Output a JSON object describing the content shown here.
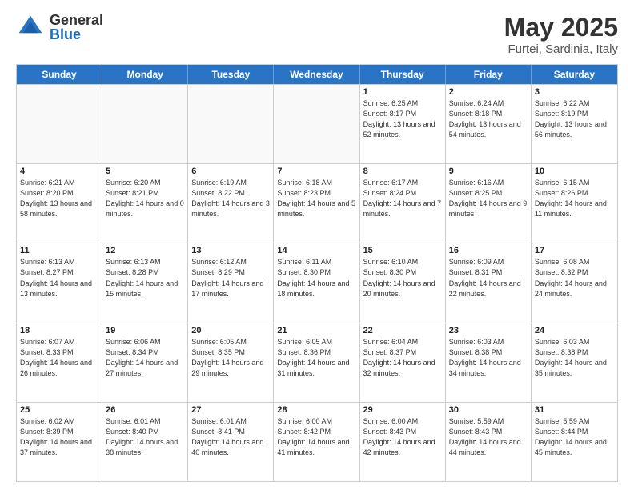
{
  "logo": {
    "general": "General",
    "blue": "Blue"
  },
  "header": {
    "month": "May 2025",
    "location": "Furtei, Sardinia, Italy"
  },
  "days": [
    "Sunday",
    "Monday",
    "Tuesday",
    "Wednesday",
    "Thursday",
    "Friday",
    "Saturday"
  ],
  "rows": [
    [
      {
        "day": "",
        "sunrise": "",
        "sunset": "",
        "daylight": ""
      },
      {
        "day": "",
        "sunrise": "",
        "sunset": "",
        "daylight": ""
      },
      {
        "day": "",
        "sunrise": "",
        "sunset": "",
        "daylight": ""
      },
      {
        "day": "",
        "sunrise": "",
        "sunset": "",
        "daylight": ""
      },
      {
        "day": "1",
        "sunrise": "Sunrise: 6:25 AM",
        "sunset": "Sunset: 8:17 PM",
        "daylight": "Daylight: 13 hours and 52 minutes."
      },
      {
        "day": "2",
        "sunrise": "Sunrise: 6:24 AM",
        "sunset": "Sunset: 8:18 PM",
        "daylight": "Daylight: 13 hours and 54 minutes."
      },
      {
        "day": "3",
        "sunrise": "Sunrise: 6:22 AM",
        "sunset": "Sunset: 8:19 PM",
        "daylight": "Daylight: 13 hours and 56 minutes."
      }
    ],
    [
      {
        "day": "4",
        "sunrise": "Sunrise: 6:21 AM",
        "sunset": "Sunset: 8:20 PM",
        "daylight": "Daylight: 13 hours and 58 minutes."
      },
      {
        "day": "5",
        "sunrise": "Sunrise: 6:20 AM",
        "sunset": "Sunset: 8:21 PM",
        "daylight": "Daylight: 14 hours and 0 minutes."
      },
      {
        "day": "6",
        "sunrise": "Sunrise: 6:19 AM",
        "sunset": "Sunset: 8:22 PM",
        "daylight": "Daylight: 14 hours and 3 minutes."
      },
      {
        "day": "7",
        "sunrise": "Sunrise: 6:18 AM",
        "sunset": "Sunset: 8:23 PM",
        "daylight": "Daylight: 14 hours and 5 minutes."
      },
      {
        "day": "8",
        "sunrise": "Sunrise: 6:17 AM",
        "sunset": "Sunset: 8:24 PM",
        "daylight": "Daylight: 14 hours and 7 minutes."
      },
      {
        "day": "9",
        "sunrise": "Sunrise: 6:16 AM",
        "sunset": "Sunset: 8:25 PM",
        "daylight": "Daylight: 14 hours and 9 minutes."
      },
      {
        "day": "10",
        "sunrise": "Sunrise: 6:15 AM",
        "sunset": "Sunset: 8:26 PM",
        "daylight": "Daylight: 14 hours and 11 minutes."
      }
    ],
    [
      {
        "day": "11",
        "sunrise": "Sunrise: 6:13 AM",
        "sunset": "Sunset: 8:27 PM",
        "daylight": "Daylight: 14 hours and 13 minutes."
      },
      {
        "day": "12",
        "sunrise": "Sunrise: 6:13 AM",
        "sunset": "Sunset: 8:28 PM",
        "daylight": "Daylight: 14 hours and 15 minutes."
      },
      {
        "day": "13",
        "sunrise": "Sunrise: 6:12 AM",
        "sunset": "Sunset: 8:29 PM",
        "daylight": "Daylight: 14 hours and 17 minutes."
      },
      {
        "day": "14",
        "sunrise": "Sunrise: 6:11 AM",
        "sunset": "Sunset: 8:30 PM",
        "daylight": "Daylight: 14 hours and 18 minutes."
      },
      {
        "day": "15",
        "sunrise": "Sunrise: 6:10 AM",
        "sunset": "Sunset: 8:30 PM",
        "daylight": "Daylight: 14 hours and 20 minutes."
      },
      {
        "day": "16",
        "sunrise": "Sunrise: 6:09 AM",
        "sunset": "Sunset: 8:31 PM",
        "daylight": "Daylight: 14 hours and 22 minutes."
      },
      {
        "day": "17",
        "sunrise": "Sunrise: 6:08 AM",
        "sunset": "Sunset: 8:32 PM",
        "daylight": "Daylight: 14 hours and 24 minutes."
      }
    ],
    [
      {
        "day": "18",
        "sunrise": "Sunrise: 6:07 AM",
        "sunset": "Sunset: 8:33 PM",
        "daylight": "Daylight: 14 hours and 26 minutes."
      },
      {
        "day": "19",
        "sunrise": "Sunrise: 6:06 AM",
        "sunset": "Sunset: 8:34 PM",
        "daylight": "Daylight: 14 hours and 27 minutes."
      },
      {
        "day": "20",
        "sunrise": "Sunrise: 6:05 AM",
        "sunset": "Sunset: 8:35 PM",
        "daylight": "Daylight: 14 hours and 29 minutes."
      },
      {
        "day": "21",
        "sunrise": "Sunrise: 6:05 AM",
        "sunset": "Sunset: 8:36 PM",
        "daylight": "Daylight: 14 hours and 31 minutes."
      },
      {
        "day": "22",
        "sunrise": "Sunrise: 6:04 AM",
        "sunset": "Sunset: 8:37 PM",
        "daylight": "Daylight: 14 hours and 32 minutes."
      },
      {
        "day": "23",
        "sunrise": "Sunrise: 6:03 AM",
        "sunset": "Sunset: 8:38 PM",
        "daylight": "Daylight: 14 hours and 34 minutes."
      },
      {
        "day": "24",
        "sunrise": "Sunrise: 6:03 AM",
        "sunset": "Sunset: 8:38 PM",
        "daylight": "Daylight: 14 hours and 35 minutes."
      }
    ],
    [
      {
        "day": "25",
        "sunrise": "Sunrise: 6:02 AM",
        "sunset": "Sunset: 8:39 PM",
        "daylight": "Daylight: 14 hours and 37 minutes."
      },
      {
        "day": "26",
        "sunrise": "Sunrise: 6:01 AM",
        "sunset": "Sunset: 8:40 PM",
        "daylight": "Daylight: 14 hours and 38 minutes."
      },
      {
        "day": "27",
        "sunrise": "Sunrise: 6:01 AM",
        "sunset": "Sunset: 8:41 PM",
        "daylight": "Daylight: 14 hours and 40 minutes."
      },
      {
        "day": "28",
        "sunrise": "Sunrise: 6:00 AM",
        "sunset": "Sunset: 8:42 PM",
        "daylight": "Daylight: 14 hours and 41 minutes."
      },
      {
        "day": "29",
        "sunrise": "Sunrise: 6:00 AM",
        "sunset": "Sunset: 8:43 PM",
        "daylight": "Daylight: 14 hours and 42 minutes."
      },
      {
        "day": "30",
        "sunrise": "Sunrise: 5:59 AM",
        "sunset": "Sunset: 8:43 PM",
        "daylight": "Daylight: 14 hours and 44 minutes."
      },
      {
        "day": "31",
        "sunrise": "Sunrise: 5:59 AM",
        "sunset": "Sunset: 8:44 PM",
        "daylight": "Daylight: 14 hours and 45 minutes."
      }
    ]
  ]
}
